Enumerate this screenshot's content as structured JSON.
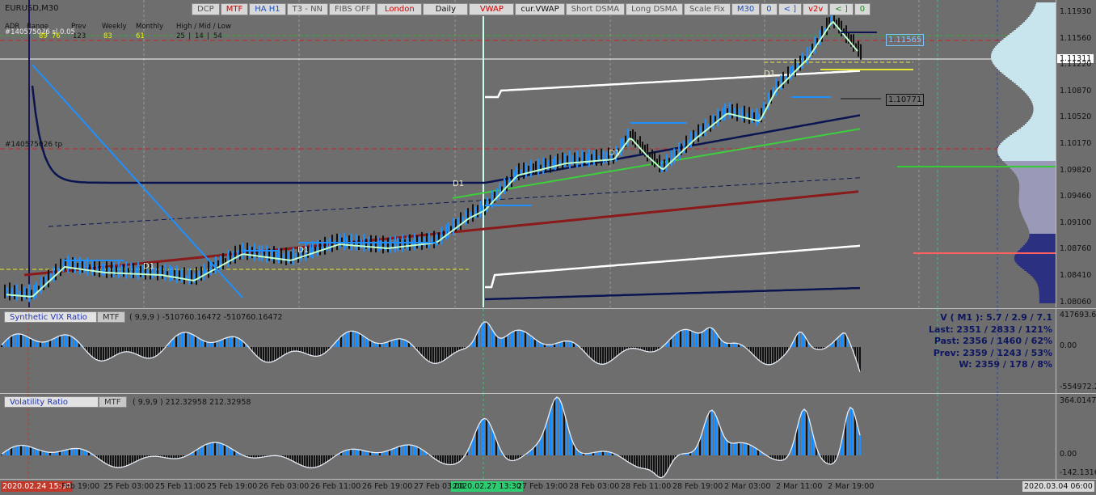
{
  "symbol": "EURUSD,M30",
  "toolbar": [
    {
      "label": "DCP",
      "color": "#555555"
    },
    {
      "label": "MTF",
      "color": "#cc0000"
    },
    {
      "label": "HA H1",
      "color": "#1a4fc0"
    },
    {
      "label": "T3 - NN",
      "color": "#555555"
    },
    {
      "label": "FIBS OFF",
      "color": "#555555"
    },
    {
      "label": "London",
      "color": "#cc0000"
    },
    {
      "label": "Daily",
      "color": "#111111"
    },
    {
      "label": "VWAP",
      "color": "#cc0000"
    },
    {
      "label": "cur.VWAP",
      "color": "#111111"
    },
    {
      "label": "Short DSMA",
      "color": "#555555"
    },
    {
      "label": "Long DSMA",
      "color": "#555555"
    },
    {
      "label": "Scale Fix",
      "color": "#555555"
    },
    {
      "label": "M30",
      "color": "#1a4fc0"
    },
    {
      "label": "0",
      "color": "#1a4fc0"
    },
    {
      "label": "< ]",
      "color": "#1a4fc0"
    },
    {
      "label": "v2v",
      "color": "#cc0000"
    },
    {
      "label": "< ]",
      "color": "#1a8a1a"
    },
    {
      "label": "0",
      "color": "#1a8a1a"
    }
  ],
  "stats": {
    "adr_label": "ADR",
    "range_label": "Range",
    "prev_label": "Prev",
    "weekly_label": "Weekly",
    "monthly_label": "Monthly",
    "hml_label": "High / Mid / Low",
    "adr": "89",
    "range": "76",
    "prev": "123",
    "weekly": "83",
    "monthly": "61",
    "high": "25",
    "mid": "14",
    "low": "54",
    "order_sl": "#140575026 sl",
    "order_sl_val": "0.05",
    "order_tp": "#140575026 tp"
  },
  "price_axis": [
    "1.11930",
    "1.11560",
    "1.11220",
    "1.10870",
    "1.10520",
    "1.10170",
    "1.09820",
    "1.09460",
    "1.09100",
    "1.08760",
    "1.08410",
    "1.08060"
  ],
  "current_price": "1.11311",
  "level_boxes": [
    {
      "text": "1.11565",
      "color": "#7ec8ff"
    },
    {
      "text": "1.10771",
      "color": "#111111"
    }
  ],
  "day_marks": [
    "D1",
    "D1",
    "D1",
    "D1",
    "D1"
  ],
  "sub1": {
    "title": "Synthetic VIX Ratio",
    "mtf": "MTF",
    "params": "( 9,9,9 ) -510760.16472 -510760.16472",
    "axis": [
      "417693.65",
      "0.00",
      "-554972.2"
    ]
  },
  "sub2": {
    "title": "Volatility Ratio",
    "mtf": "MTF",
    "params": "( 9,9,9 ) 212.32958 212.32958",
    "axis": [
      "364.01472",
      "0.00",
      "-142.1316"
    ]
  },
  "vstats": [
    "V ( M1 ): 5.7 / 2.9 / 7.1",
    "Last: 2351 / 2833 / 121%",
    "Past: 2356 / 1460 / 62%",
    "Prev: 2359 / 1243 / 53%",
    "W: 2359 / 178 / 8%"
  ],
  "time_axis": {
    "start_highlight": "2020.02.24 15:00",
    "mid_highlight": "2020.02.27 13:30",
    "end_highlight": "2020.03.04 06:00",
    "labels": [
      "Feb 19:00",
      "25 Feb 03:00",
      "25 Feb 11:00",
      "25 Feb 19:00",
      "26 Feb 03:00",
      "26 Feb 11:00",
      "26 Feb 19:00",
      "27 Feb 03:00",
      "27 Feb 19:00",
      "28 Feb 03:00",
      "28 Feb 11:00",
      "28 Feb 19:00",
      "2 Mar 03:00",
      "2 Mar 11:00",
      "2 Mar 19:00"
    ]
  },
  "colors": {
    "background": "#6e6e6e",
    "bull": "#1e90ff",
    "bear": "#111111",
    "vwap": "#0a1450",
    "red_ma": "#8b1a1a",
    "green_ma": "#3ecf3e",
    "accent_red": "#cc0000"
  }
}
